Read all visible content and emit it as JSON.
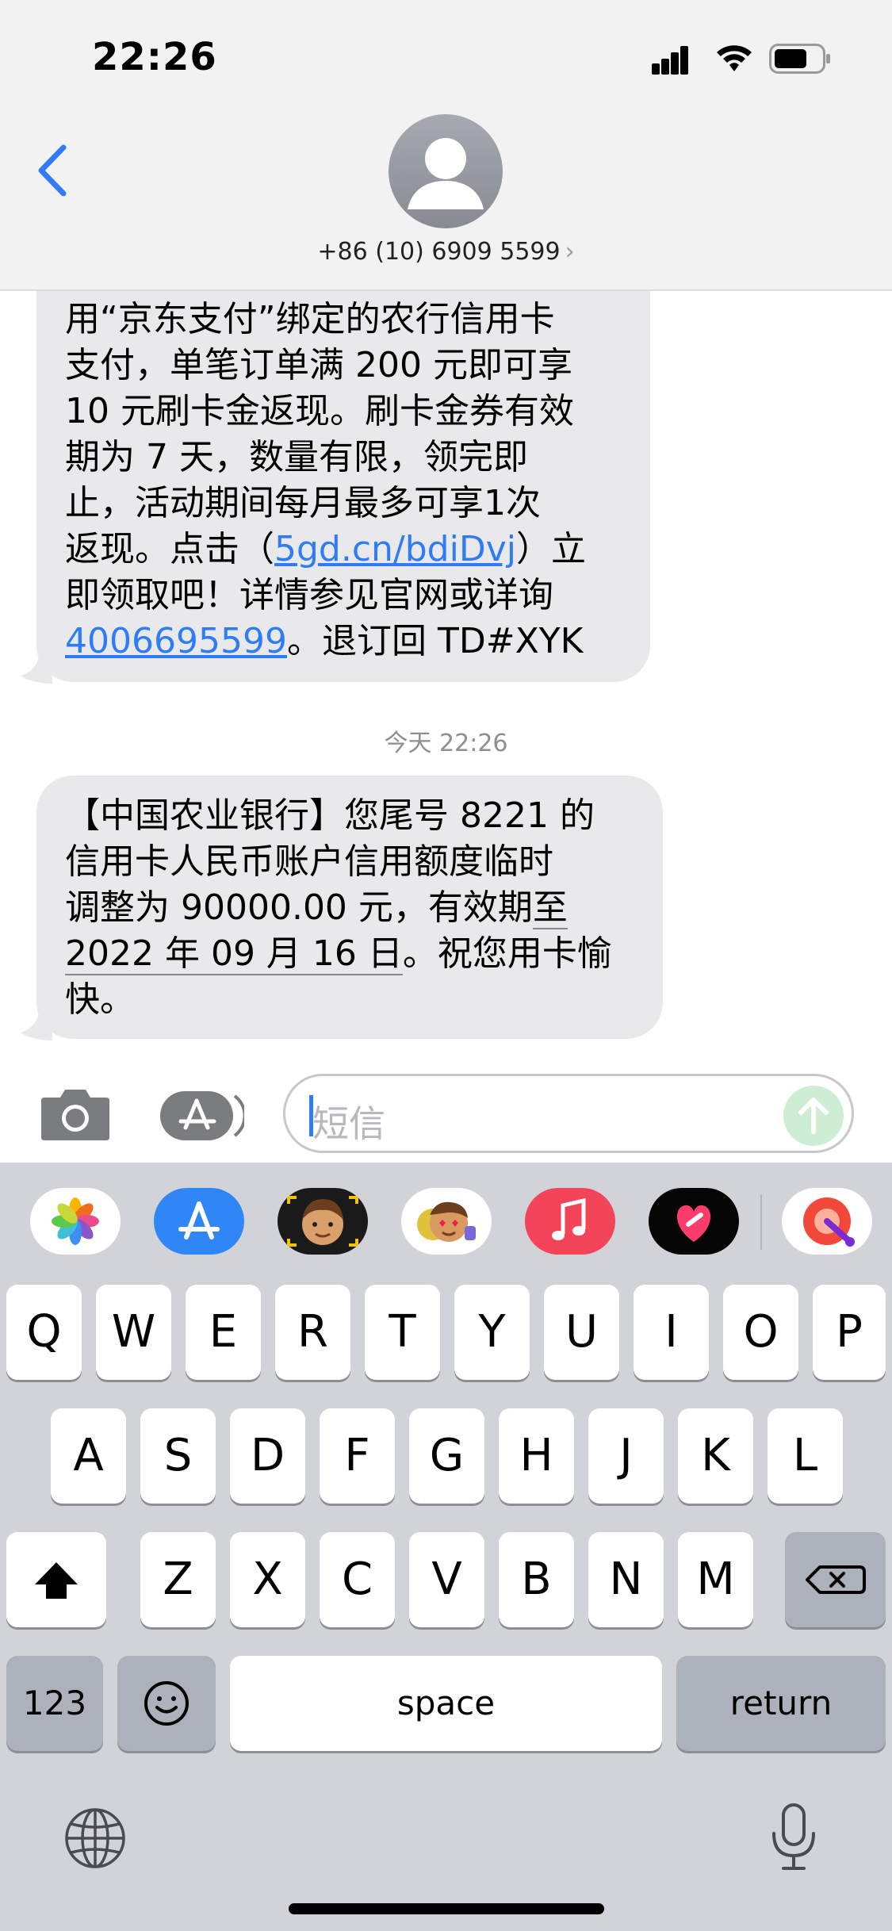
{
  "status_bar": {
    "time": "22:26"
  },
  "header": {
    "contact": "+86 (10) 6909 5599",
    "chevron": "›"
  },
  "messages": {
    "msg1": {
      "lines": [
        "用“京东支付”绑定的农行信用卡",
        "支付，单笔订单满 200 元即可享",
        "10 元刷卡金返现。刷卡金券有效",
        "期为 7 天，数量有限，领完即",
        "止，活动期间每月最多可享1次"
      ],
      "line6_pre": "返现。点击（",
      "line6_link": "5gd.cn/bdiDvj",
      "line6_post": "）立",
      "line7": "即领取吧！详情参见官网或详询",
      "line8_link": "4006695599",
      "line8_post": "。退订回 TD#XYK"
    },
    "timestamp": "今天 22:26",
    "msg2": {
      "line1": "【中国农业银行】您尾号 8221 的",
      "line2": "信用卡人民币账户信用额度临时",
      "line3_pre": "调整为 90000.00 元，有效期",
      "line3_ul": "至",
      "line4_ul": "2022 年 09 月 16 日",
      "line4_post": "。祝您用卡愉",
      "line5": "快。"
    }
  },
  "input": {
    "placeholder": "短信"
  },
  "keyboard": {
    "row1": [
      "Q",
      "W",
      "E",
      "R",
      "T",
      "Y",
      "U",
      "I",
      "O",
      "P"
    ],
    "row2": [
      "A",
      "S",
      "D",
      "F",
      "G",
      "H",
      "J",
      "K",
      "L"
    ],
    "row3": [
      "Z",
      "X",
      "C",
      "V",
      "B",
      "N",
      "M"
    ],
    "numbers": "123",
    "space": "space",
    "return": "return"
  },
  "app_strip": [
    "photos-icon",
    "app-store-icon",
    "memoji-icon",
    "animoji-stickers-icon",
    "music-icon",
    "digital-touch-icon",
    "app-icon"
  ],
  "colors": {
    "link": "#2f7cf6",
    "bubble": "#e9e9eb",
    "keyboard_bg": "#d1d3d9",
    "send": "#cdeed2"
  }
}
